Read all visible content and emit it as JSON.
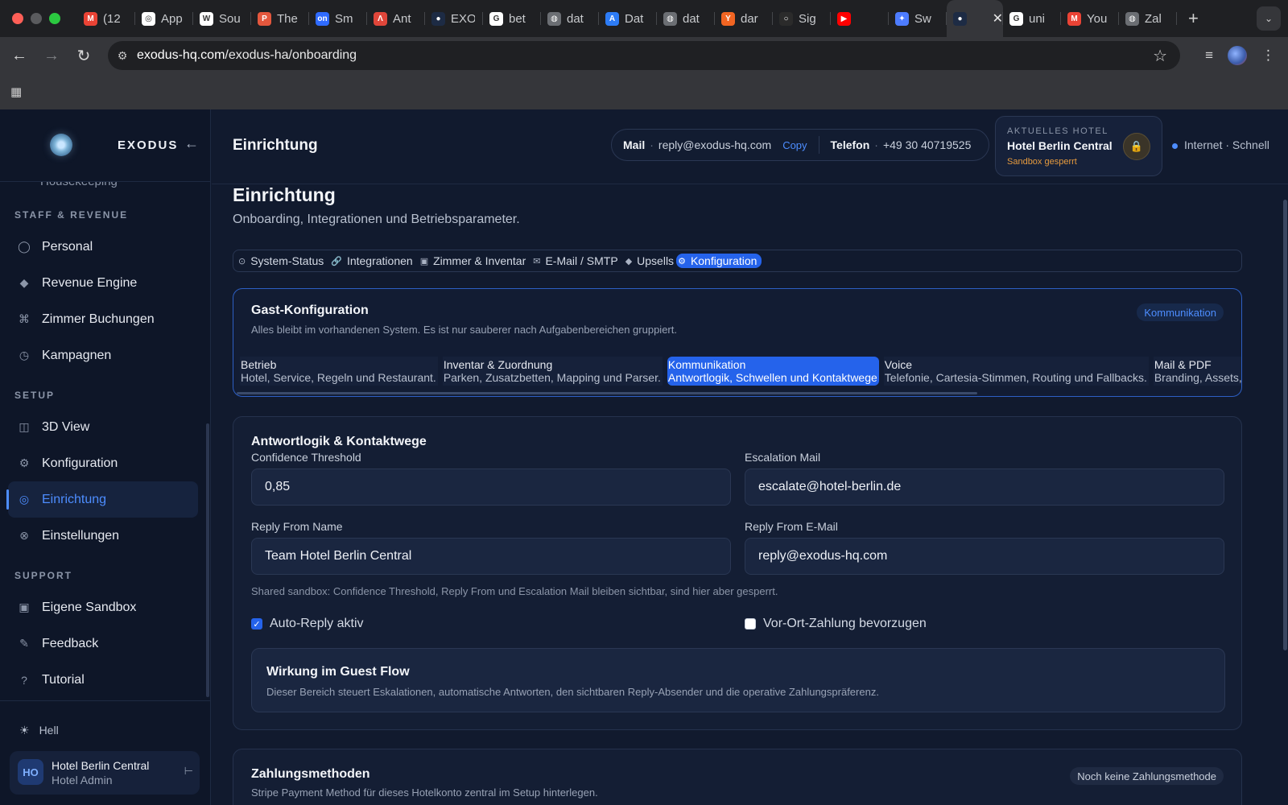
{
  "browser": {
    "tabs": [
      {
        "title": "(12",
        "icon": "gmail-icon",
        "color": "#ea4335",
        "glyph": "M"
      },
      {
        "title": "App",
        "icon": "openai-icon",
        "color": "#ffffff",
        "glyph": "◎"
      },
      {
        "title": "Sou",
        "icon": "wix-icon",
        "color": "#ffffff",
        "glyph": "W"
      },
      {
        "title": "The",
        "icon": "p-icon",
        "color": "#e4573d",
        "glyph": "P"
      },
      {
        "title": "Sm",
        "icon": "on-icon",
        "color": "#2f6bff",
        "glyph": "on"
      },
      {
        "title": "Ant",
        "icon": "anthropic-icon",
        "color": "#e0463a",
        "glyph": "Λ"
      },
      {
        "title": "EXO",
        "icon": "exodus-icon",
        "color": "#1d2b44",
        "glyph": "●"
      },
      {
        "title": "bet",
        "icon": "google-icon",
        "color": "#ffffff",
        "glyph": "G"
      },
      {
        "title": "dat",
        "icon": "globe-icon",
        "color": "#6b6e73",
        "glyph": "◍"
      },
      {
        "title": "Dat",
        "icon": "appstore-icon",
        "color": "#2d7cf6",
        "glyph": "A"
      },
      {
        "title": "dat",
        "icon": "globe-icon",
        "color": "#6b6e73",
        "glyph": "◍"
      },
      {
        "title": "dar",
        "icon": "ycombinator-icon",
        "color": "#f26522",
        "glyph": "Y"
      },
      {
        "title": "Sig",
        "icon": "github-icon",
        "color": "#2b2b2b",
        "glyph": "○"
      },
      {
        "title": "",
        "icon": "youtube-icon",
        "color": "#ff0000",
        "glyph": "▶"
      },
      {
        "title": "Sw",
        "icon": "gemini-icon",
        "color": "#4d7cff",
        "glyph": "✦"
      },
      {
        "title": "",
        "icon": "exodus-icon",
        "color": "#1d2b44",
        "glyph": "●",
        "active": true
      },
      {
        "title": "uni",
        "icon": "google-icon",
        "color": "#ffffff",
        "glyph": "G"
      },
      {
        "title": "You",
        "icon": "gmail-icon",
        "color": "#ea4335",
        "glyph": "M"
      },
      {
        "title": "Zal",
        "icon": "globe-icon",
        "color": "#6b6e73",
        "glyph": "◍"
      }
    ],
    "url_domain": "exodus-hq.com",
    "url_path": "/exodus-ha/onboarding"
  },
  "sidebar": {
    "brand": "EXODUS",
    "cut_item": "Housekeeping",
    "sections": [
      {
        "title": "STAFF & REVENUE",
        "items": [
          {
            "label": "Personal",
            "icon": "circle-icon",
            "glyph": "◯"
          },
          {
            "label": "Revenue Engine",
            "icon": "diamond-icon",
            "glyph": "◆"
          },
          {
            "label": "Zimmer Buchungen",
            "icon": "command-icon",
            "glyph": "⌘"
          },
          {
            "label": "Kampagnen",
            "icon": "clock-icon",
            "glyph": "◷"
          }
        ]
      },
      {
        "title": "SETUP",
        "items": [
          {
            "label": "3D View",
            "icon": "cube-icon",
            "glyph": "◫"
          },
          {
            "label": "Konfiguration",
            "icon": "gear-icon",
            "glyph": "⚙"
          },
          {
            "label": "Einrichtung",
            "icon": "target-icon",
            "glyph": "◎",
            "active": true
          },
          {
            "label": "Einstellungen",
            "icon": "settings-icon",
            "glyph": "⊗"
          }
        ]
      },
      {
        "title": "SUPPORT",
        "items": [
          {
            "label": "Eigene Sandbox",
            "icon": "square-icon",
            "glyph": "▣"
          },
          {
            "label": "Feedback",
            "icon": "pen-icon",
            "glyph": "✎"
          },
          {
            "label": "Tutorial",
            "icon": "question-icon",
            "glyph": "?"
          }
        ]
      }
    ],
    "theme_label": "Hell",
    "user": {
      "initials": "HO",
      "name": "Hotel Berlin Central",
      "role": "Hotel Admin"
    }
  },
  "header": {
    "title": "Einrichtung",
    "mail_label": "Mail",
    "mail_value": "reply@exodus-hq.com",
    "copy_label": "Copy",
    "phone_label": "Telefon",
    "phone_value": "+49 30 40719525",
    "hotel_caption": "AKTUELLES HOTEL",
    "hotel_name": "Hotel Berlin Central",
    "sandbox_status": "Sandbox gesperrt",
    "network_status": "Internet · Schnell"
  },
  "page": {
    "title": "Einrichtung",
    "subtitle": "Onboarding, Integrationen und Betriebsparameter.",
    "crumbs": [
      {
        "label": "System-Status",
        "glyph": "⊙"
      },
      {
        "label": "Integrationen",
        "glyph": "🔗"
      },
      {
        "label": "Zimmer & Inventar",
        "glyph": "▣"
      },
      {
        "label": "E-Mail / SMTP",
        "glyph": "✉"
      },
      {
        "label": "Upsells",
        "glyph": "◆"
      },
      {
        "label": "Konfiguration",
        "glyph": "⚙",
        "active": true
      }
    ]
  },
  "guest_config": {
    "title": "Gast-Konfiguration",
    "description": "Alles bleibt im vorhandenen System. Es ist nur sauberer nach Aufgabenbereichen gruppiert.",
    "badge": "Kommunikation",
    "tabs": [
      {
        "title": "Betrieb",
        "desc": "Hotel, Service, Regeln und Restaurant."
      },
      {
        "title": "Inventar & Zuordnung",
        "desc": "Parken, Zusatzbetten, Mapping und Parser."
      },
      {
        "title": "Kommunikation",
        "desc": "Antwortlogik, Schwellen und Kontaktwege",
        "active": true
      },
      {
        "title": "Voice",
        "desc": "Telefonie, Cartesia-Stimmen, Routing und Fallbacks."
      },
      {
        "title": "Mail & PDF",
        "desc": "Branding, Assets, Footer"
      }
    ]
  },
  "answer_logic": {
    "title": "Antwortlogik & Kontaktwege",
    "confidence_label": "Confidence Threshold",
    "confidence_value": "0,85",
    "escalation_label": "Escalation Mail",
    "escalation_value": "escalate@hotel-berlin.de",
    "reply_name_label": "Reply From Name",
    "reply_name_value": "Team Hotel Berlin Central",
    "reply_mail_label": "Reply From E-Mail",
    "reply_mail_value": "reply@exodus-hq.com",
    "note": "Shared sandbox: Confidence Threshold, Reply From und Escalation Mail bleiben sichtbar, sind hier aber gesperrt.",
    "auto_reply_label": "Auto-Reply aktiv",
    "auto_reply_checked": true,
    "onsite_payment_label": "Vor-Ort-Zahlung bevorzugen",
    "onsite_payment_checked": false,
    "flow_title": "Wirkung im Guest Flow",
    "flow_text": "Dieser Bereich steuert Eskalationen, automatische Antworten, den sichtbaren Reply-Absender und die operative Zahlungspräferenz."
  },
  "payments": {
    "title": "Zahlungsmethoden",
    "description": "Stripe Payment Method für dieses Hotelkonto zentral im Setup hinterlegen.",
    "badge": "Noch keine Zahlungsmethode"
  },
  "colors": {
    "accent": "#2563eb",
    "accent_text": "#4d8dff",
    "warning": "#e79b3e",
    "bg": "#111a2e"
  }
}
